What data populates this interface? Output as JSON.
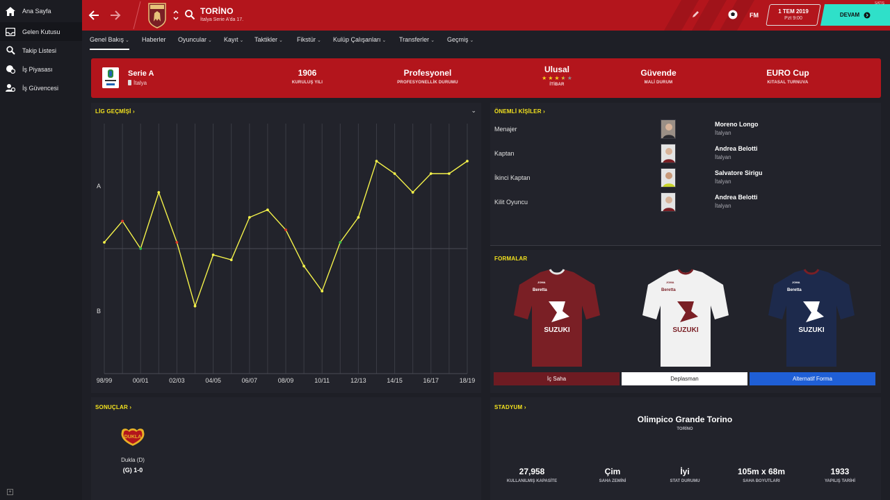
{
  "sidebar": {
    "items": [
      {
        "label": "Ana Sayfa",
        "icon": "home-icon"
      },
      {
        "label": "Gelen Kutusu",
        "icon": "inbox-icon"
      },
      {
        "label": "Takip Listesi",
        "icon": "search-icon"
      },
      {
        "label": "İş Piyasası",
        "icon": "job-market-icon"
      },
      {
        "label": "İş Güvencesi",
        "icon": "job-security-icon"
      }
    ],
    "bottom_icon": "plus-box-icon"
  },
  "header": {
    "club_name": "TORİNO",
    "club_sub": "İtalya Serie A'da 17.",
    "fm_logo": "FM",
    "date": "1 TEM 2019",
    "time": "Pzt 9:00",
    "continue_label": "DEVAM",
    "corner_label": "SATIŞ"
  },
  "tabs": [
    {
      "label": "Genel Bakış",
      "active": true
    },
    {
      "label": "Haberler",
      "chevron": false
    },
    {
      "label": "Oyuncular"
    },
    {
      "label": "Kayıt"
    },
    {
      "label": "Taktikler"
    },
    {
      "label": "Fikstür"
    },
    {
      "label": "Kulüp Çalışanları"
    },
    {
      "label": "Transferler"
    },
    {
      "label": "Geçmiş"
    }
  ],
  "club_info": {
    "league": "Serie A",
    "country": "İtalya",
    "founded": {
      "value": "1906",
      "label": "KURULUŞ YILI"
    },
    "status": {
      "value": "Profesyonel",
      "label": "PROFESYONELLİK DURUMU"
    },
    "reputation": {
      "value": "Ulusal",
      "label": "İTİBAR",
      "stars": 3.5,
      "max_stars": 5
    },
    "finance": {
      "value": "Güvende",
      "label": "MALİ DURUM"
    },
    "continental": {
      "value": "EURO Cup",
      "label": "KITASAL TURNUVA"
    }
  },
  "league_history": {
    "title": "LİG GEÇMİŞİ",
    "chart_data": {
      "type": "line",
      "x": [
        "98/99",
        "99/00",
        "00/01",
        "01/02",
        "02/03",
        "03/04",
        "04/05",
        "05/06",
        "06/07",
        "07/08",
        "08/09",
        "09/10",
        "10/11",
        "11/12",
        "12/13",
        "13/14",
        "14/15",
        "15/16",
        "16/17",
        "17/18",
        "18/19"
      ],
      "tick_labels": [
        "98/99",
        "00/01",
        "02/03",
        "04/05",
        "06/07",
        "08/09",
        "10/11",
        "12/13",
        "14/15",
        "16/17",
        "18/19"
      ],
      "y_labels": [
        "A",
        "B"
      ],
      "values": [
        0.05,
        0.22,
        0.0,
        0.45,
        0.05,
        -0.46,
        -0.05,
        -0.09,
        0.25,
        0.31,
        0.15,
        -0.14,
        -0.34,
        0.05,
        0.25,
        0.7,
        0.6,
        0.45,
        0.6,
        0.6,
        0.7
      ],
      "values_note": "A = 0.5, B = -0.5, midline = 0",
      "markers": {
        "promotion": [
          2,
          13
        ],
        "relegation": [
          1,
          4,
          10
        ]
      },
      "colors": {
        "line": "#f4f24a",
        "promotion": "#36c24a",
        "relegation": "#e33a2a"
      }
    }
  },
  "results": {
    "title": "SONUÇLAR",
    "team": "Dukla (D)",
    "score": "(G) 1-0",
    "crest_text": "DUKLA"
  },
  "key_people": {
    "title": "ÖNEMLİ KİŞİLER",
    "people": [
      {
        "role": "Menajer",
        "name": "Moreno Longo",
        "nationality": "İtalyan"
      },
      {
        "role": "Kaptan",
        "name": "Andrea Belotti",
        "nationality": "İtalyan"
      },
      {
        "role": "İkinci Kaptan",
        "name": "Salvatore Sirigu",
        "nationality": "İtalyan"
      },
      {
        "role": "Kilit Oyuncu",
        "name": "Andrea Belotti",
        "nationality": "İtalyan"
      }
    ]
  },
  "kits": {
    "title": "FORMALAR",
    "items": [
      {
        "label": "İç Saha",
        "color": "#7a1f25"
      },
      {
        "label": "Deplasman",
        "color": "#ffffff"
      },
      {
        "label": "Alternatif Forma",
        "color": "#1f5fd6"
      }
    ],
    "sponsor": "SUZUKI",
    "kit_maker": "JOMA",
    "sleeve_sponsor": "Beretta"
  },
  "stadium": {
    "title": "STADYUM",
    "name": "Olimpico Grande Torino",
    "city": "TORİNO",
    "facts": [
      {
        "value": "27,958",
        "label": "KULLANILMIŞ KAPASİTE"
      },
      {
        "value": "Çim",
        "label": "SAHA ZEMİNİ"
      },
      {
        "value": "İyi",
        "label": "STAT DURUMU"
      },
      {
        "value": "105m x 68m",
        "label": "SAHA BOYUTLARI"
      },
      {
        "value": "1933",
        "label": "YAPILIŞ TARİHİ"
      }
    ]
  },
  "colors": {
    "primary": "#b3151c",
    "accent": "#f4e31e",
    "continue": "#2fe0c9",
    "panel": "#22232b"
  }
}
